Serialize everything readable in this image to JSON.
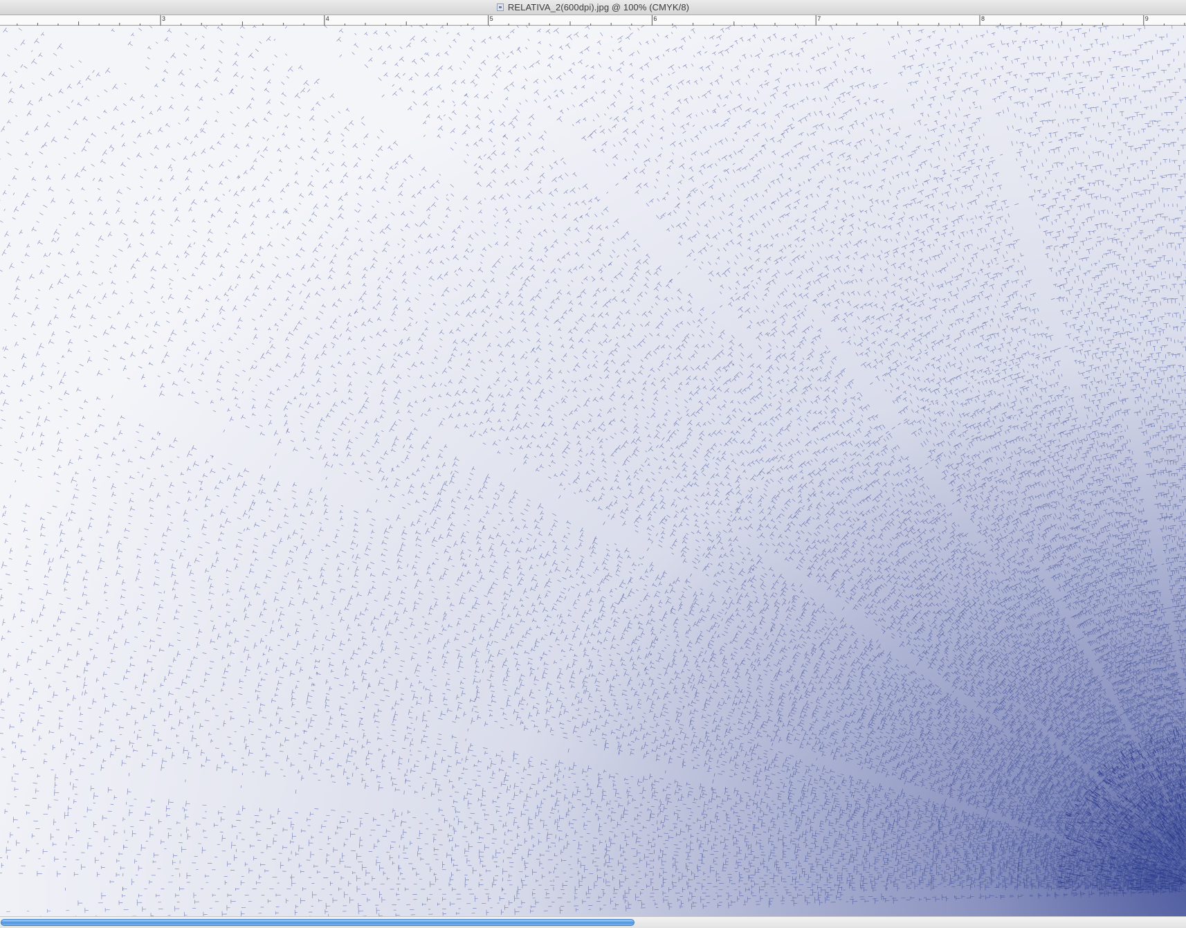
{
  "window": {
    "title": "RELATIVA_2(600dpi).jpg @ 100% (CMYK/8)",
    "icons": [
      "document-icon"
    ]
  },
  "ruler": {
    "labels": [
      "3",
      "4",
      "5",
      "6",
      "7",
      "8",
      "9"
    ]
  },
  "canvas": {
    "content": "dense blue typographic radial pattern",
    "ink_color": "#2a3a8c",
    "background_color": "#ffffff"
  },
  "scrollbar": {
    "horizontal_position": 0.0,
    "visible_fraction": 0.535,
    "thumb_color": "#4f95e2"
  }
}
